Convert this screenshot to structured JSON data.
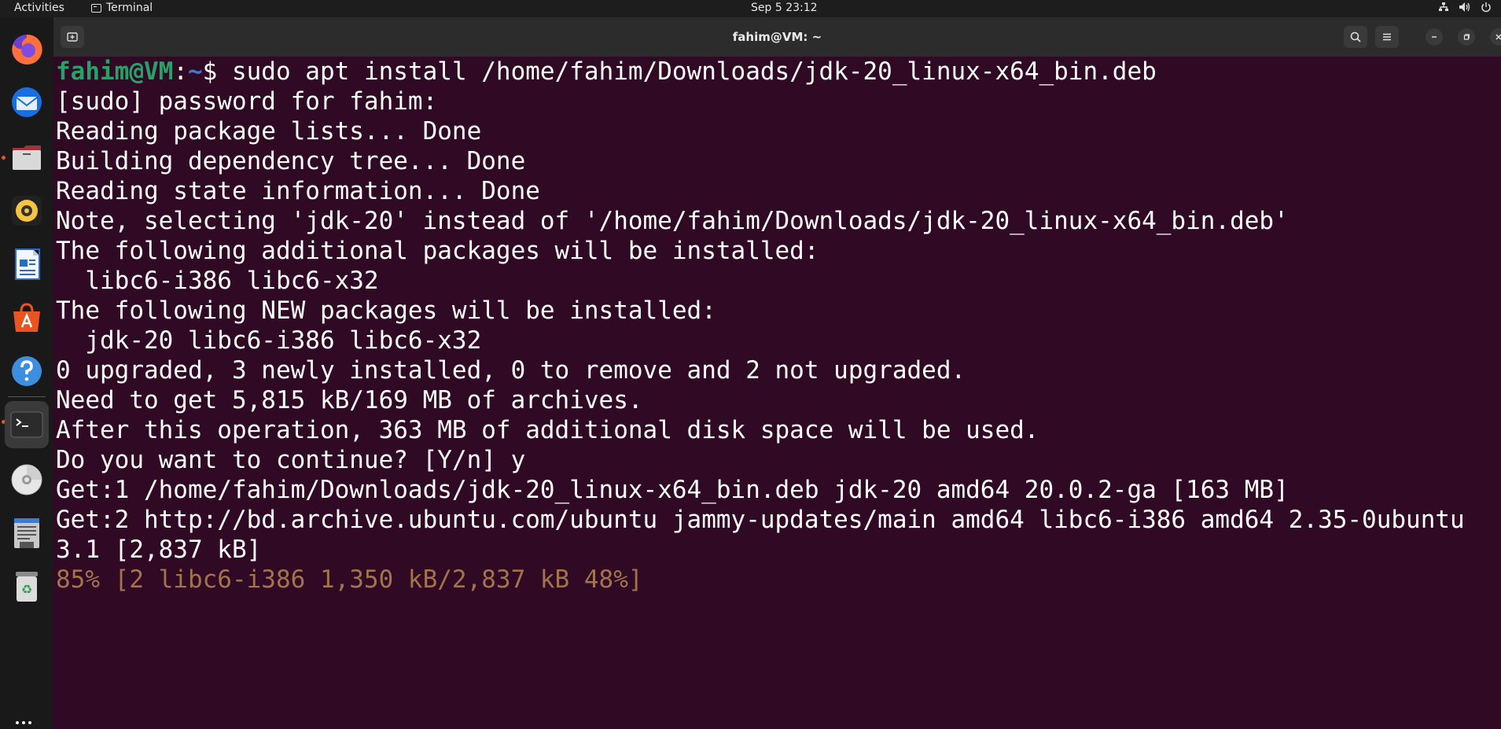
{
  "topbar": {
    "activities": "Activities",
    "app_name": "Terminal",
    "clock": "Sep 5  23:12"
  },
  "dock": {
    "items": [
      {
        "name": "firefox-icon"
      },
      {
        "name": "thunderbird-icon"
      },
      {
        "name": "files-icon"
      },
      {
        "name": "rhythmbox-icon"
      },
      {
        "name": "libreoffice-writer-icon"
      },
      {
        "name": "app-center-icon"
      },
      {
        "name": "help-icon"
      },
      {
        "name": "terminal-icon"
      },
      {
        "name": "dvd-icon"
      },
      {
        "name": "text-editor-icon"
      },
      {
        "name": "trash-icon"
      }
    ]
  },
  "window": {
    "title": "fahim@VM: ~"
  },
  "terminal": {
    "prompt_user": "fahim@VM",
    "prompt_sep": ":",
    "prompt_path": "~",
    "prompt_symbol": "$ ",
    "command": "sudo apt install /home/fahim/Downloads/jdk-20_linux-x64_bin.deb",
    "lines": [
      "[sudo] password for fahim:",
      "Reading package lists... Done",
      "Building dependency tree... Done",
      "Reading state information... Done",
      "Note, selecting 'jdk-20' instead of '/home/fahim/Downloads/jdk-20_linux-x64_bin.deb'",
      "The following additional packages will be installed:",
      "  libc6-i386 libc6-x32",
      "The following NEW packages will be installed:",
      "  jdk-20 libc6-i386 libc6-x32",
      "0 upgraded, 3 newly installed, 0 to remove and 2 not upgraded.",
      "Need to get 5,815 kB/169 MB of archives.",
      "After this operation, 363 MB of additional disk space will be used.",
      "Do you want to continue? [Y/n] y",
      "Get:1 /home/fahim/Downloads/jdk-20_linux-x64_bin.deb jdk-20 amd64 20.0.2-ga [163 MB]",
      "Get:2 http://bd.archive.ubuntu.com/ubuntu jammy-updates/main amd64 libc6-i386 amd64 2.35-0ubuntu",
      "3.1 [2,837 kB]"
    ],
    "progress_line": "85% [2 libc6-i386 1,350 kB/2,837 kB 48%]"
  },
  "colors": {
    "terminal_bg": "#300a24",
    "prompt_user": "#26a269",
    "prompt_path": "#3d7ad3",
    "progress": "#a2734c",
    "accent": "#e95420"
  }
}
